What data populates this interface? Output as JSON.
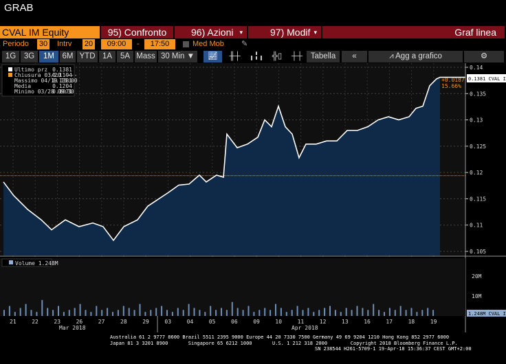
{
  "window": {
    "title": "GRAB"
  },
  "header": {
    "ticker": "CVAL IM Equity",
    "compare": "95) Confronto",
    "actions": "96) Azioni",
    "edit": "97) Modif",
    "chart_type": "Graf linea"
  },
  "settings": {
    "period_label": "Periodo",
    "period": "30",
    "interval_label": "Intrv",
    "interval": "20",
    "start": "09:00",
    "dash": "-",
    "end": "17:50",
    "moving_avg": "Med Mob"
  },
  "toolbar": {
    "ranges": [
      "1G",
      "3G",
      "1M",
      "6M",
      "YTD",
      "1A",
      "5A",
      "Mass"
    ],
    "active_range": "1M",
    "bar_size": "30 Min ▼",
    "table": "Tabella",
    "collapse": "«",
    "add": "Agg a grafico"
  },
  "legend": [
    {
      "label": "Ultimo prz",
      "value": "0.1381",
      "color": "#ffffff"
    },
    {
      "label": "Chiusura 03/20 ----",
      "value": "0.1194",
      "color": "#f7941d"
    },
    {
      "label": "Massimo 04/19 15:00",
      "value": "0.1381"
    },
    {
      "label": "Media",
      "value": "0.1204"
    },
    {
      "label": "Minimo 03/28 09:30",
      "value": "0.1071"
    }
  ],
  "price_tag": "0.1381 CVAL IM",
  "change": {
    "abs": "+0.0187",
    "pct": "15.66%"
  },
  "volume": {
    "legend": "Volume 1.248M",
    "tag": "1.248M CVAL IM",
    "ticks": [
      "20M",
      "10M"
    ]
  },
  "chart_data": {
    "type": "line",
    "ylim": [
      0.105,
      0.14
    ],
    "yticks": [
      "0.14",
      "0.135",
      "0.13",
      "0.125",
      "0.12",
      "0.115",
      "0.11",
      "0.105"
    ],
    "prev_close": 0.1194,
    "x": [
      1,
      4,
      8,
      12,
      15,
      19,
      23,
      27,
      30,
      33,
      36,
      40,
      43,
      46,
      49,
      52,
      55,
      58,
      60,
      63,
      65,
      66,
      69,
      72,
      75,
      77,
      79,
      81,
      83,
      85,
      87,
      89,
      92,
      95,
      98,
      101,
      104,
      107,
      110,
      113,
      116,
      119,
      121,
      123,
      125,
      127,
      128
    ],
    "values": [
      0.1182,
      0.1156,
      0.113,
      0.111,
      0.1091,
      0.111,
      0.1097,
      0.1104,
      0.1097,
      0.1071,
      0.1097,
      0.111,
      0.1136,
      0.1149,
      0.1162,
      0.1176,
      0.1178,
      0.1195,
      0.1182,
      0.1195,
      0.1191,
      0.1273,
      0.1247,
      0.1254,
      0.1267,
      0.13,
      0.1287,
      0.1326,
      0.1287,
      0.1273,
      0.1228,
      0.1254,
      0.1254,
      0.126,
      0.126,
      0.128,
      0.128,
      0.1287,
      0.13,
      0.1306,
      0.13,
      0.1306,
      0.1322,
      0.1326,
      0.1365,
      0.1378,
      0.1381
    ],
    "volume_m": [
      3,
      5,
      2,
      4,
      6,
      3,
      2,
      8,
      4,
      3,
      5,
      2,
      3,
      4,
      6,
      3,
      2,
      5,
      3,
      4,
      2,
      3,
      5,
      4,
      3,
      6,
      2,
      3,
      4,
      5,
      3,
      2,
      4,
      3,
      6,
      4,
      3,
      2,
      5,
      3,
      4,
      3,
      7,
      4,
      3,
      5,
      2,
      3,
      4,
      3,
      6,
      4,
      2,
      3,
      5,
      3,
      4,
      2,
      3,
      4,
      5,
      3,
      2,
      4,
      3,
      5,
      4,
      3,
      6,
      3,
      2,
      4,
      3,
      5,
      3,
      4,
      2,
      3,
      4,
      3
    ],
    "xticks": [
      "21",
      "22",
      "23",
      "26",
      "27",
      "28",
      "29",
      "03",
      "04",
      "05",
      "06",
      "09",
      "10",
      "11",
      "12",
      "13",
      "16",
      "17",
      "18",
      "19"
    ],
    "months": [
      "Mar 2018",
      "Apr 2018"
    ]
  },
  "footer": {
    "line1": "Australia 61 2 9777 8600 Brazil 5511 2395 9000 Europe 44 20 7330 7500 Germany 49 69 9204 1210 Hong Kong 852 2977 6000",
    "line2": "Japan 81 3 3201 8900       Singapore 65 6212 1000       U.S. 1 212 318 2000        Copyright 2018 Bloomberg Finance L.P.",
    "line3": "SN 238544 H261-5709-1 19-Apr-18 15:36:37 CEST GMT+2:00"
  }
}
